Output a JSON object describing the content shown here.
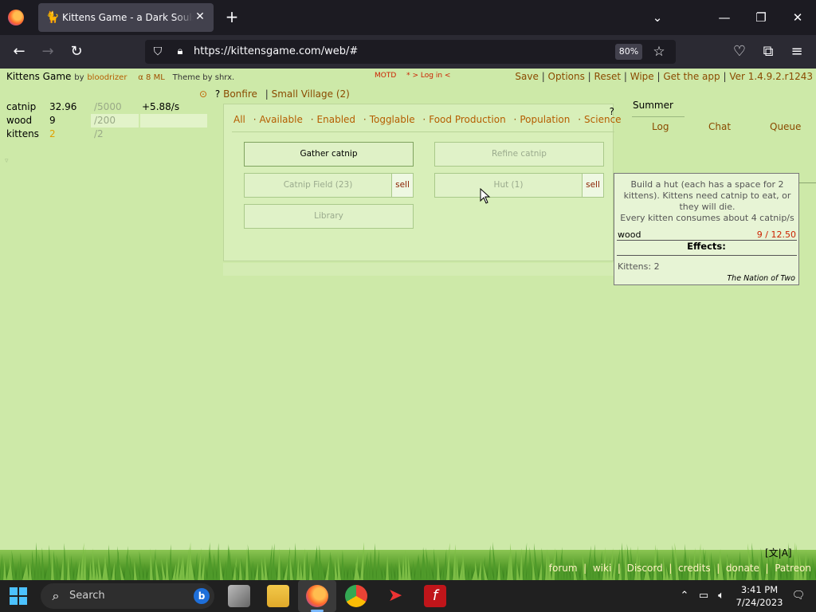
{
  "browser": {
    "tab_title": "Kittens Game - a Dark Souls of idle games",
    "url": "https://kittensgame.com/web/#",
    "zoom": "80%"
  },
  "game": {
    "title": "Kittens Game",
    "by": "by",
    "author": "bloodrizer",
    "links_small": "α  8  ML",
    "theme": "Theme by shrx.",
    "motd": "MOTD",
    "login": "* > Log in <",
    "top_links": [
      "Save",
      "Options",
      "Reset",
      "Wipe",
      "Get the app",
      "Ver 1.4.9.2.r1243"
    ]
  },
  "resources": [
    {
      "name": "catnip",
      "value": "32.96",
      "max": "/5000",
      "rate": "+5.88/s"
    },
    {
      "name": "wood",
      "value": "9",
      "max": "/200",
      "rate": ""
    },
    {
      "name": "kittens",
      "value": "2",
      "max": "/2",
      "rate": ""
    }
  ],
  "nav": {
    "icon": "⊙",
    "question": "?",
    "bonfire": "Bonfire",
    "village": "Small Village (2)"
  },
  "filters": [
    "All",
    "Available",
    "Enabled",
    "Togglable",
    "Food Production",
    "Population",
    "Science"
  ],
  "panel_help": "?",
  "buildings": {
    "gather": "Gather catnip",
    "refine": "Refine catnip",
    "field": "Catnip Field (23)",
    "hut": "Hut (1)",
    "library": "Library",
    "sell": "sell"
  },
  "right": {
    "season": "Summer",
    "tabs": [
      "Log",
      "Chat",
      "Queue"
    ]
  },
  "tooltip": {
    "desc": "Build a hut (each has a space for 2 kittens). Kittens need catnip to eat, or they will die.",
    "desc2": "Every kitten consumes about 4 catnip/s",
    "res_name": "wood",
    "res_amount": "9 / 12.50",
    "effects_label": "Effects:",
    "kittens": "Kittens: 2",
    "flavor": "The Nation of Two"
  },
  "footer": {
    "lang": "[文|A]",
    "links": [
      "forum",
      "wiki",
      "Discord",
      "credits",
      "donate",
      "Patreon"
    ]
  },
  "taskbar": {
    "search": "Search",
    "time": "3:41 PM",
    "date": "7/24/2023"
  }
}
